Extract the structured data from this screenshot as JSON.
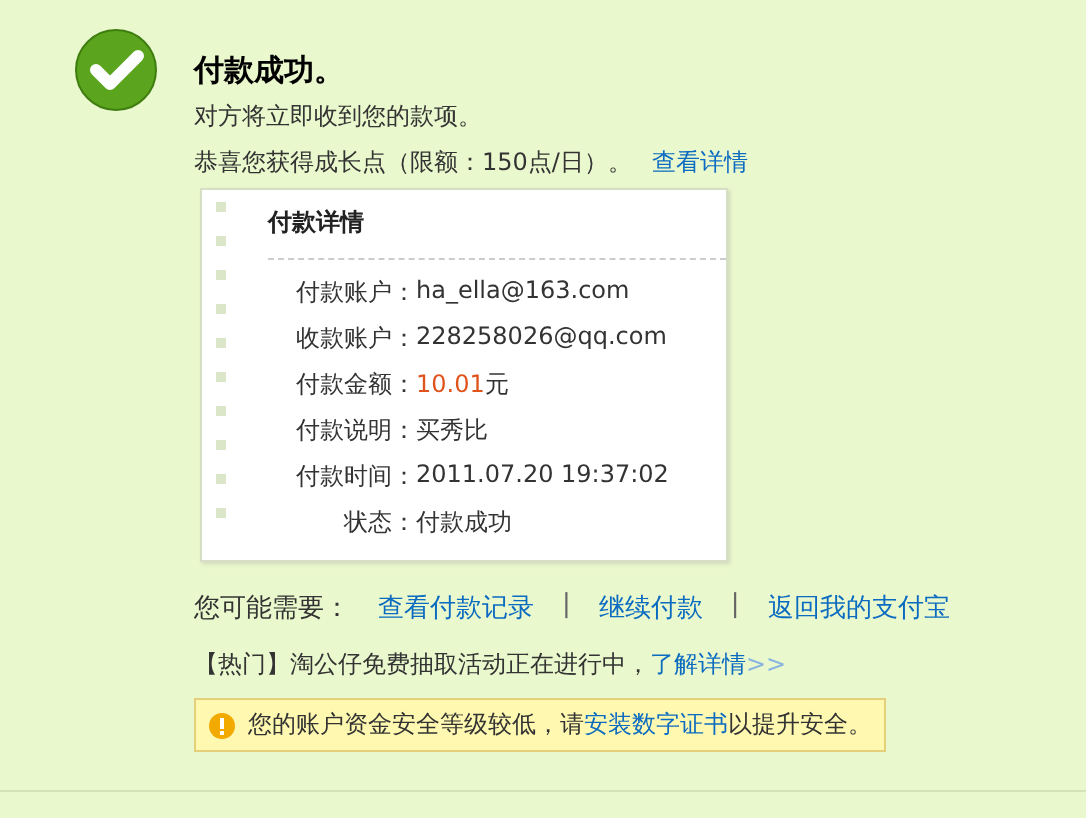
{
  "result": {
    "title": "付款成功。",
    "message": "对方将立即收到您的款项。",
    "bonus": "恭喜您获得成长点（限额：150点/日）。",
    "bonus_link": "查看详情"
  },
  "details": {
    "title": "付款详情",
    "rows": [
      {
        "kind": "text",
        "label": "付款账户：",
        "value": "ha_ella@163.com"
      },
      {
        "kind": "text",
        "label": "收款账户：",
        "value": "228258026@qq.com"
      },
      {
        "kind": "amount",
        "label": "付款金额：",
        "value": "10.01",
        "unit": "元"
      },
      {
        "kind": "text",
        "label": "付款说明：",
        "value": "买秀比"
      },
      {
        "kind": "text",
        "label": "付款时间：",
        "value": "2011.07.20 19:37:02"
      },
      {
        "kind": "text",
        "label": "状态：",
        "value": "付款成功"
      }
    ]
  },
  "next_steps": {
    "label": "您可能需要：",
    "links": [
      "查看付款记录",
      "继续付款",
      "返回我的支付宝"
    ],
    "separator": "|"
  },
  "promo": {
    "text": "【热门】淘公仔免费抽取活动正在进行中，",
    "link": "了解详情",
    "arrow": ">>"
  },
  "warning": {
    "before": "您的账户资金安全等级较低，请",
    "link": "安装数字证书",
    "after": "以提升安全。"
  }
}
